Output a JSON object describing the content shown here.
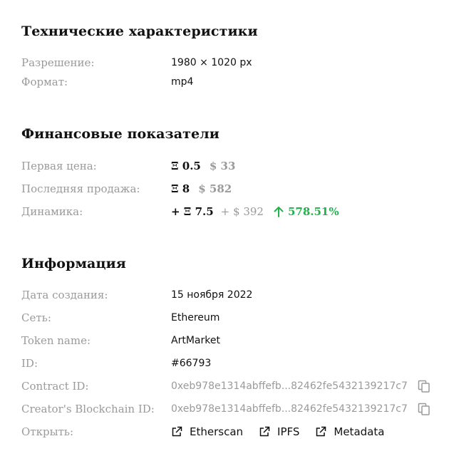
{
  "tech": {
    "title": "Технические характеристики",
    "resolution_label": "Разрешение:",
    "resolution_value": "1980 × 1020 px",
    "format_label": "Формат:",
    "format_value": "mp4"
  },
  "finance": {
    "title": "Финансовые показатели",
    "first_price_label": "Первая цена:",
    "first_price_eth": "Ξ 0.5",
    "first_price_usd": "$ 33",
    "last_sale_label": "Последняя продажа:",
    "last_sale_eth": "Ξ 8",
    "last_sale_usd": "$ 582",
    "dynamics_label": "Динамика:",
    "dynamics_eth": "+ Ξ 7.5",
    "dynamics_usd": "+ $ 392",
    "dynamics_pct": "578.51%",
    "positive_color": "#22b14c"
  },
  "info": {
    "title": "Информация",
    "created_label": "Дата создания:",
    "created_value": "15 ноября 2022",
    "network_label": "Сеть:",
    "network_value": "Ethereum",
    "token_name_label": "Token name:",
    "token_name_value": "ArtMarket",
    "id_label": "ID:",
    "id_value": "#66793",
    "contract_label": "Contract ID:",
    "contract_value": "0xeb978e1314abffefb...82462fe5432139217c7",
    "creator_label": "Creator's Blockchain ID:",
    "creator_value": "0xeb978e1314abffefb...82462fe5432139217c7",
    "open_label": "Открыть:",
    "links": [
      "Etherscan",
      "IPFS",
      "Metadata"
    ]
  }
}
